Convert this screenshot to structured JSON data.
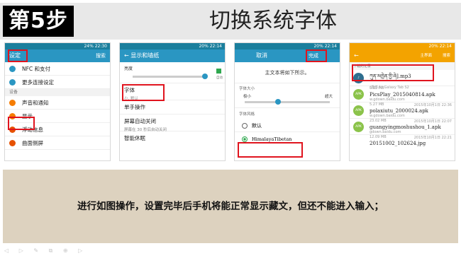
{
  "header": {
    "step": "第5步",
    "title": "切换系统字体"
  },
  "phone1": {
    "status": "24% 22:30",
    "title": "设定",
    "action": "搜索",
    "items": [
      {
        "label": "NFC 和支付"
      },
      {
        "label": "更多连接设定"
      }
    ],
    "section": "设备",
    "items2": [
      {
        "label": "声音和通知"
      },
      {
        "label": "显示"
      },
      {
        "label": "浮动信息"
      },
      {
        "label": "曲面侧屏"
      }
    ]
  },
  "phone2": {
    "status": "20% 22:14",
    "title": "显示和墙纸",
    "brightness_label": "亮度",
    "auto_label": "自动",
    "font_label": "字体",
    "font_sub": "小, 默认",
    "onehand_label": "单手操作",
    "timeout_label": "屏幕自动关闭",
    "timeout_sub": "屏幕在 30 秒后自动关闭",
    "smartstay_label": "智能休眠"
  },
  "phone3": {
    "status": "20% 22:14",
    "cancel": "取消",
    "done": "完成",
    "preview": "主文本将如下所示。",
    "size_label": "字体大小",
    "size_min": "极小",
    "size_max": "超大",
    "style_label": "字体风格",
    "style_default": "默认",
    "style_tibetan": "HimalayaTibetan"
  },
  "phone4": {
    "status": "20% 22:14",
    "btn1": "主界面",
    "btn2": "搜索",
    "section": "下载的记录",
    "files": [
      {
        "name": "ཀུན་མཁྱེན་གྱི་ཞེ].mp3",
        "meta": "(发件人) Galaxy Tab S2",
        "size": "3.92 MB",
        "date": ""
      },
      {
        "name": "PicsPlay_2015040814.apk",
        "meta": "w.gdown.baidu.com",
        "size": "5.27 MB",
        "date": "2015年10月1日 22:36"
      },
      {
        "name": "polaxiutu_2000024.apk",
        "meta": "w.gdown.baidu.com",
        "size": "23.02 MB",
        "date": "2015年10月1日 22:07"
      },
      {
        "name": "guangyingmoshushou_1.apk",
        "meta": "gdown.baidu.com",
        "size": "12.09 MB",
        "date": "2015年10月1日 22:21"
      },
      {
        "name": "20151002_102624.jpg",
        "meta": "",
        "size": "",
        "date": ""
      }
    ]
  },
  "note": {
    "text": "进行如图操作，设置完毕后手机将能正常显示藏文，但还不能进入输入；"
  },
  "toolbar": {
    "icons": "◁ ▷ ✎ ⧉ ⊕ ▷"
  }
}
